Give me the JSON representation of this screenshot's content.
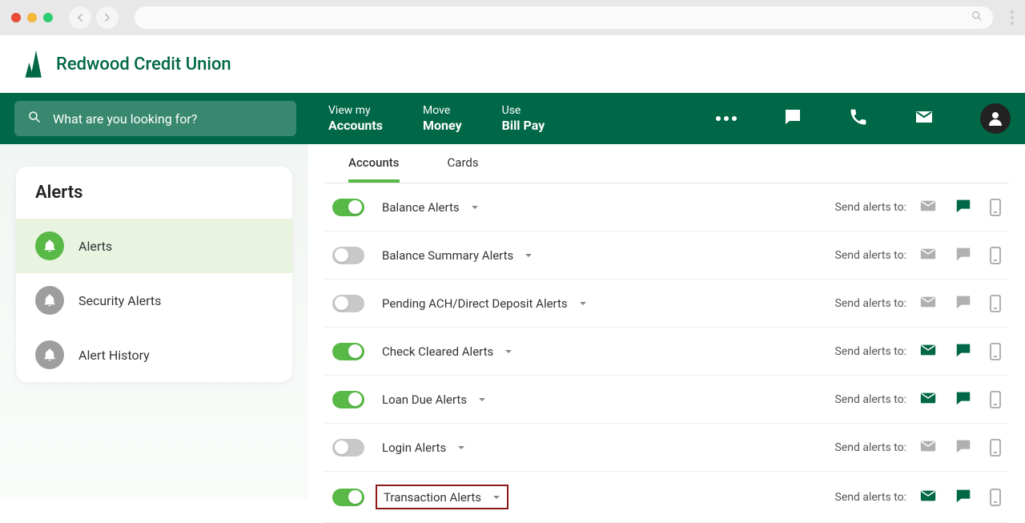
{
  "brand": {
    "name": "Redwood Credit Union"
  },
  "search": {
    "placeholder": "What are you looking for?"
  },
  "nav": {
    "links": [
      {
        "line1": "View my",
        "line2": "Accounts"
      },
      {
        "line1": "Move",
        "line2": "Money"
      },
      {
        "line1": "Use",
        "line2": "Bill Pay"
      }
    ]
  },
  "sidebar": {
    "title": "Alerts",
    "items": [
      {
        "label": "Alerts",
        "active": true
      },
      {
        "label": "Security Alerts",
        "active": false
      },
      {
        "label": "Alert History",
        "active": false
      }
    ]
  },
  "tabs": [
    {
      "label": "Accounts",
      "active": true
    },
    {
      "label": "Cards",
      "active": false
    }
  ],
  "send_to_label": "Send alerts to:",
  "alerts": [
    {
      "label": "Balance Alerts",
      "on": true,
      "email": false,
      "chat": true,
      "phone": false,
      "highlight": false
    },
    {
      "label": "Balance Summary Alerts",
      "on": false,
      "email": false,
      "chat": false,
      "phone": false,
      "highlight": false
    },
    {
      "label": "Pending ACH/Direct Deposit Alerts",
      "on": false,
      "email": false,
      "chat": false,
      "phone": false,
      "highlight": false
    },
    {
      "label": "Check Cleared Alerts",
      "on": true,
      "email": true,
      "chat": true,
      "phone": false,
      "highlight": false
    },
    {
      "label": "Loan Due Alerts",
      "on": true,
      "email": true,
      "chat": true,
      "phone": false,
      "highlight": false
    },
    {
      "label": "Login Alerts",
      "on": false,
      "email": false,
      "chat": false,
      "phone": false,
      "highlight": false
    },
    {
      "label": "Transaction Alerts",
      "on": true,
      "email": true,
      "chat": true,
      "phone": false,
      "highlight": true
    }
  ]
}
